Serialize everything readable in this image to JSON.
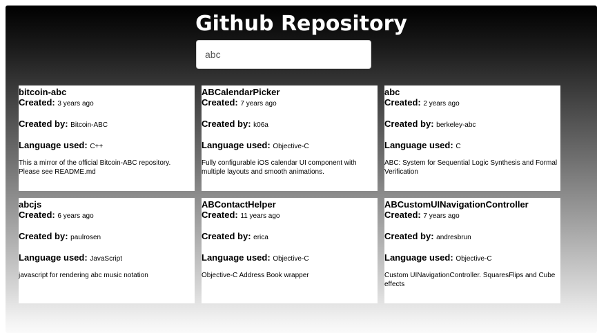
{
  "page": {
    "title": "Github Repository"
  },
  "search": {
    "value": "abc"
  },
  "labels": {
    "created": "Created:",
    "created_by": "Created by:",
    "language": "Language used:"
  },
  "repos": [
    {
      "name": "bitcoin-abc",
      "created": "3 years ago",
      "created_by": "Bitcoin-ABC",
      "language": "C++",
      "description": "This a mirror of the official Bitcoin-ABC repository. Please see README.md"
    },
    {
      "name": "ABCalendarPicker",
      "created": "7 years ago",
      "created_by": "k06a",
      "language": "Objective-C",
      "description": "Fully configurable iOS calendar UI component with multiple layouts and smooth animations."
    },
    {
      "name": "abc",
      "created": "2 years ago",
      "created_by": "berkeley-abc",
      "language": "C",
      "description": "ABC: System for Sequential Logic Synthesis and Formal Verification"
    },
    {
      "name": "abcjs",
      "created": "6 years ago",
      "created_by": "paulrosen",
      "language": "JavaScript",
      "description": "javascript for rendering abc music notation"
    },
    {
      "name": "ABContactHelper",
      "created": "11 years ago",
      "created_by": "erica",
      "language": "Objective-C",
      "description": "Objective-C Address Book wrapper"
    },
    {
      "name": "ABCustomUINavigationController",
      "created": "7 years ago",
      "created_by": "andresbrun",
      "language": "Objective-C",
      "description": "Custom UINavigationController. SquaresFlips and Cube effects"
    }
  ]
}
